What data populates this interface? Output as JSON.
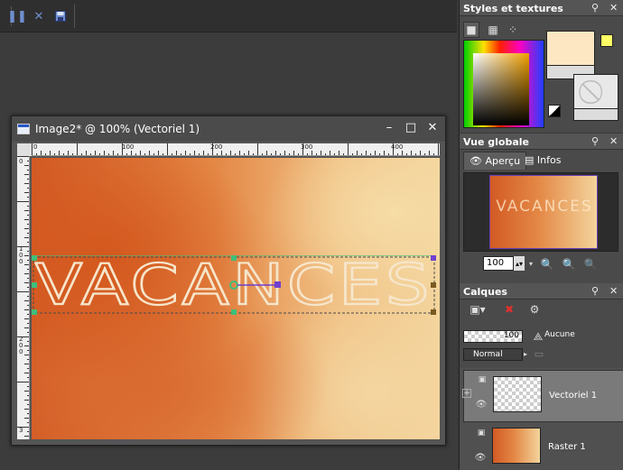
{
  "toolbar": {
    "icons": [
      "pause-icon",
      "close-x-icon",
      "save-icon"
    ],
    "colors": {
      "icon": "#6f8fd0"
    }
  },
  "image_window": {
    "title": "Image2* @ 100% (Vectoriel 1)",
    "controls": {
      "minimize": "–",
      "maximize": "□",
      "close": "✕"
    },
    "ruler_h_labels": [
      "0",
      "100",
      "200",
      "300",
      "400"
    ],
    "ruler_v_labels": [
      "0",
      "1 0 0",
      "2 0 0",
      "3"
    ],
    "canvas_text": "VACANCES",
    "colors": {
      "text": "#f4e3c8",
      "selection": "#4a4a4a",
      "handle_green": "#3dbf7a",
      "handle_purple": "#7040d0"
    }
  },
  "styles_panel": {
    "title": "Styles et textures",
    "pin": "📌",
    "close": "✕",
    "foreground_color": "#fde7c3",
    "background_color": "#ffff66"
  },
  "overview_panel": {
    "title": "Vue globale",
    "tabs": [
      "Aperçu",
      "Infos"
    ],
    "active_tab": "Aperçu",
    "thumb_text": "VACANCES",
    "zoom_value": "100"
  },
  "layers_panel": {
    "title": "Calques",
    "opacity": "100",
    "mask_label": "Aucune",
    "blend_mode": "Normal",
    "layers": [
      {
        "name": "Vectoriel 1",
        "selected": true
      },
      {
        "name": "Raster 1",
        "selected": false
      }
    ]
  }
}
